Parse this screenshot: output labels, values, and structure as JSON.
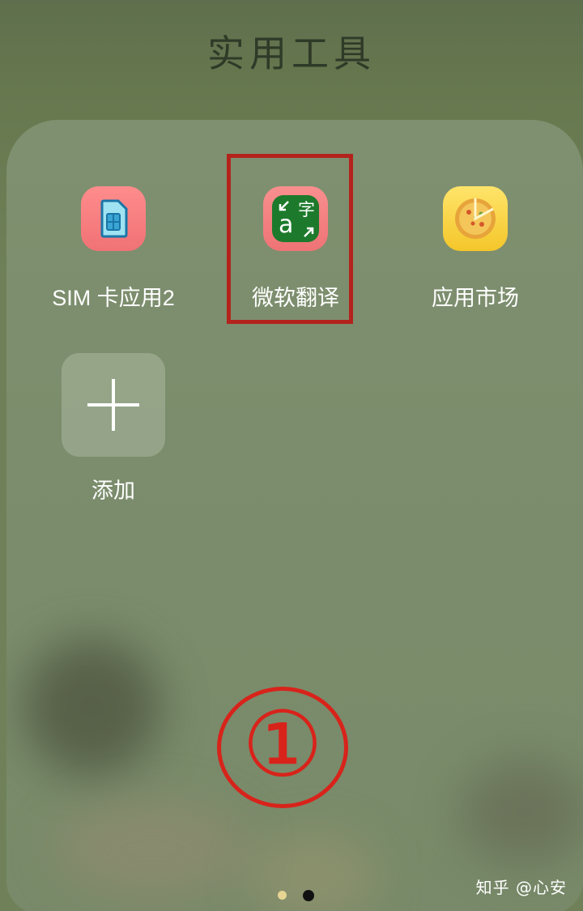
{
  "folder": {
    "title": "实用工具"
  },
  "apps": [
    {
      "label": "SIM 卡应用2",
      "icon": "sim-card-icon"
    },
    {
      "label": "微软翻译",
      "icon": "microsoft-translator-icon",
      "icon_text_a": "a",
      "icon_text_zi": "字"
    },
    {
      "label": "应用市场",
      "icon": "app-store-icon"
    }
  ],
  "add": {
    "label": "添加",
    "icon": "plus-icon"
  },
  "annotation": {
    "marker": "①"
  },
  "watermark": "知乎 @心安",
  "colors": {
    "highlight": "#b3231c",
    "annotation": "#d8231b"
  }
}
